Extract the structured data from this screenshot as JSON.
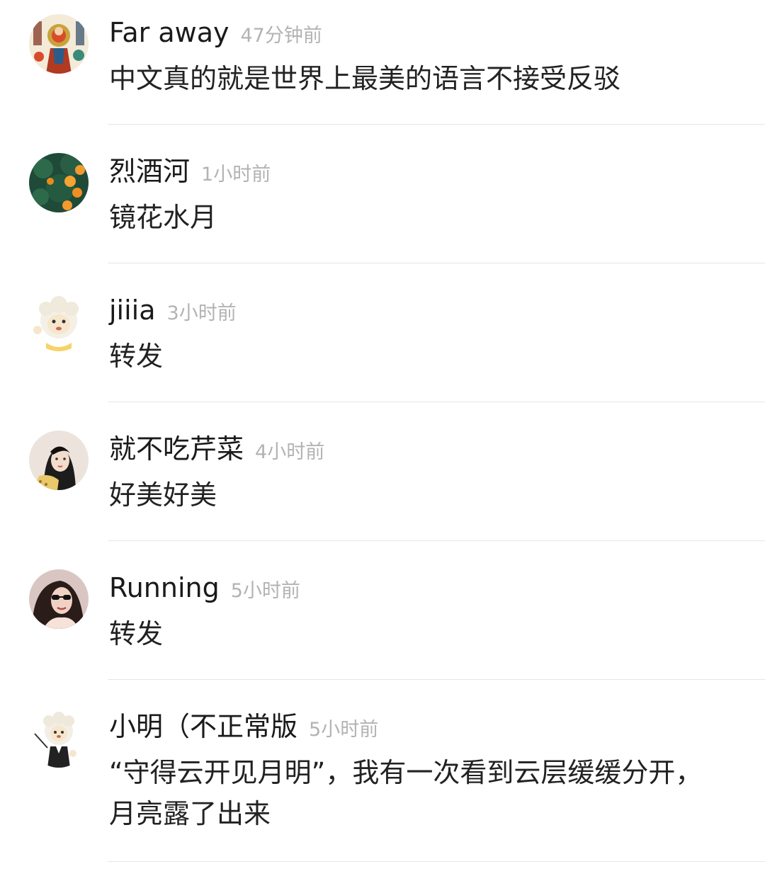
{
  "comments": [
    {
      "username": "Far away",
      "time": "47分钟前",
      "text": "中文真的就是世界上最美的语言不接受反驳",
      "avatar_icon": "buddhist-art-avatar"
    },
    {
      "username": "烈酒河",
      "time": "1小时前",
      "text": "镜花水月",
      "avatar_icon": "orange-tree-avatar"
    },
    {
      "username": "jiiia",
      "time": "3小时前",
      "text": "转发",
      "avatar_icon": "cartoon-sheep-avatar"
    },
    {
      "username": "就不吃芹菜",
      "time": "4小时前",
      "text": "好美好美",
      "avatar_icon": "girl-portrait-avatar"
    },
    {
      "username": "Running",
      "time": "5小时前",
      "text": "转发",
      "avatar_icon": "sunglasses-girl-avatar"
    },
    {
      "username": "小明（不正常版",
      "time": "5小时前",
      "text": "“守得云开见月明”，我有一次看到云层缓缓分开，月亮露了出来",
      "avatar_icon": "sheep-conductor-avatar"
    }
  ],
  "colors": {
    "username": "#1a1a1a",
    "timestamp": "#b3b3b3",
    "divider": "#e6e6e6"
  }
}
